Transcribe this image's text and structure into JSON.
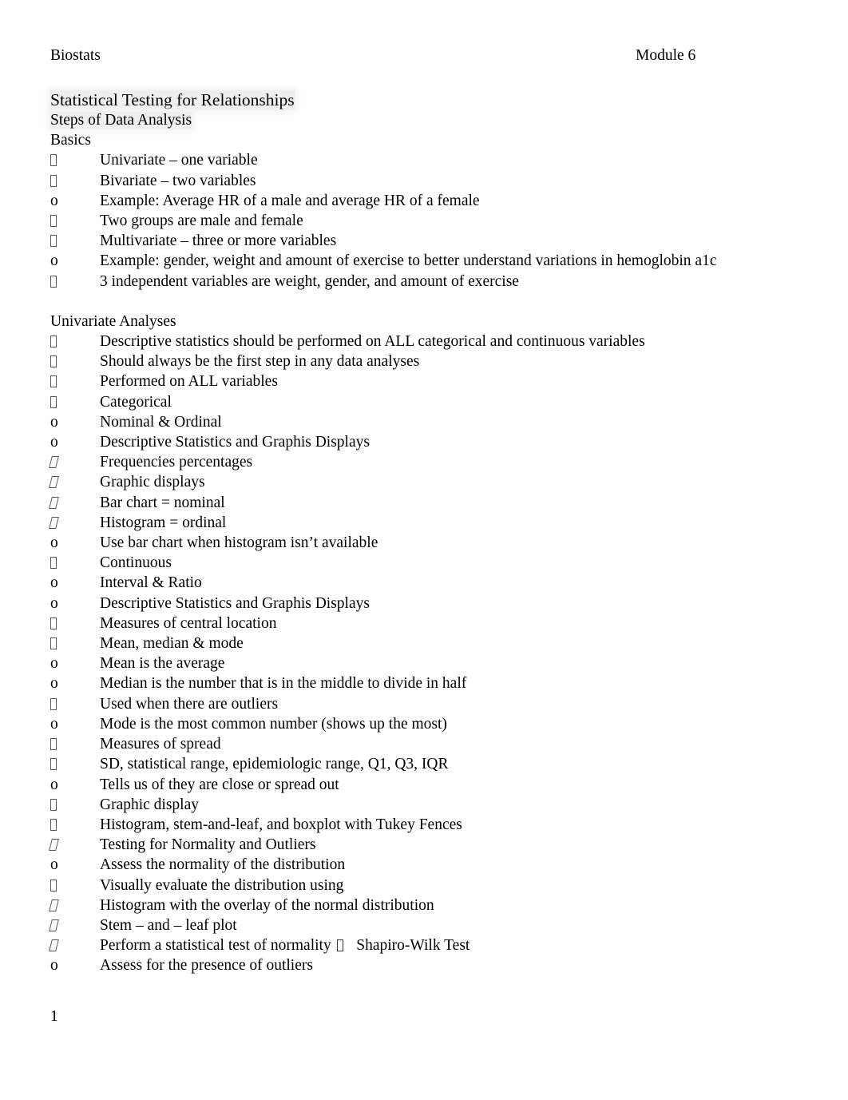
{
  "document": {
    "header": {
      "left": "Biostats",
      "right": "Module 6"
    },
    "footer": {
      "page_number": "1"
    },
    "title_lines": [
      "Statistical Testing for Relationships",
      "Steps of Data Analysis"
    ],
    "sections": [
      {
        "heading": "Basics",
        "items": [
          {
            "level": 1,
            "bullet": "tofu",
            "text": "Univariate – one variable"
          },
          {
            "level": 1,
            "bullet": "tofu",
            "text": "Bivariate – two variables"
          },
          {
            "level": 2,
            "bullet": "o",
            "text": "Example: Average HR of a male and average HR of a female"
          },
          {
            "level": 3,
            "bullet": "tofu",
            "text": "Two groups are male and female"
          },
          {
            "level": 1,
            "bullet": "tofu",
            "text": "Multivariate – three or more variables"
          },
          {
            "level": 2,
            "bullet": "o",
            "text": "Example: gender, weight and amount of exercise to better understand variations in hemoglobin a1c"
          },
          {
            "level": 3,
            "bullet": "tofu",
            "text": "3 independent variables are weight, gender, and amount of exercise"
          }
        ]
      },
      {
        "heading": "Univariate Analyses",
        "items": [
          {
            "level": 1,
            "bullet": "tofu",
            "text": "Descriptive statistics should be performed on ALL categorical and continuous variables"
          },
          {
            "level": 1,
            "bullet": "tofu",
            "text": "Should always be the first step in any data analyses"
          },
          {
            "level": 1,
            "bullet": "tofu",
            "text": "Performed on ALL variables"
          },
          {
            "level": 1,
            "bullet": "tofu",
            "text": "Categorical"
          },
          {
            "level": 2,
            "bullet": "o",
            "text": "Nominal & Ordinal"
          },
          {
            "level": 2,
            "bullet": "o",
            "text": "Descriptive Statistics and Graphis Displays"
          },
          {
            "level": 3,
            "bullet": "tofu-i",
            "text": "Frequencies percentages"
          },
          {
            "level": 3,
            "bullet": "tofu-i",
            "text": "Graphic displays"
          },
          {
            "level": 4,
            "bullet": "tofu-i",
            "text": "Bar chart = nominal"
          },
          {
            "level": 4,
            "bullet": "tofu-i",
            "text": "Histogram = ordinal"
          },
          {
            "level": 5,
            "bullet": "o",
            "text": "Use bar chart when histogram isn’t available"
          },
          {
            "level": 1,
            "bullet": "tofu",
            "text": "Continuous"
          },
          {
            "level": 2,
            "bullet": "o",
            "text": "Interval & Ratio"
          },
          {
            "level": 2,
            "bullet": "o",
            "text": "Descriptive Statistics and Graphis Displays"
          },
          {
            "level": 3,
            "bullet": "tofu",
            "text": "Measures of central location"
          },
          {
            "level": 4,
            "bullet": "tofu",
            "text": "Mean, median & mode"
          },
          {
            "level": 5,
            "bullet": "o",
            "text": "Mean is the average"
          },
          {
            "level": 5,
            "bullet": "o",
            "text": "Median is the number that is in the middle to divide in half"
          },
          {
            "level": 6,
            "bullet": "tofu",
            "text": "Used when there are outliers"
          },
          {
            "level": 5,
            "bullet": "o",
            "text": "Mode is the most common number (shows up the most)"
          },
          {
            "level": 3,
            "bullet": "tofu",
            "text": "Measures of spread"
          },
          {
            "level": 4,
            "bullet": "tofu",
            "text": "SD, statistical range, epidemiologic range, Q1, Q3, IQR"
          },
          {
            "level": 5,
            "bullet": "o",
            "text": "Tells us of they are close or spread out"
          },
          {
            "level": 3,
            "bullet": "tofu",
            "text": "Graphic display"
          },
          {
            "level": 4,
            "bullet": "tofu",
            "text": "Histogram, stem-and-leaf, and boxplot with Tukey Fences"
          },
          {
            "level": 1,
            "bullet": "tofu-i",
            "text": "Testing for Normality and Outliers"
          },
          {
            "level": 2,
            "bullet": "o",
            "text": "Assess the normality of the distribution"
          },
          {
            "level": 3,
            "bullet": "tofu",
            "text": "Visually evaluate the distribution using"
          },
          {
            "level": 4,
            "bullet": "tofu-i",
            "text": "Histogram with the overlay of the normal distribution"
          },
          {
            "level": 4,
            "bullet": "tofu-i",
            "text": "Stem – and – leaf plot"
          },
          {
            "level": 3,
            "bullet": "tofu-i",
            "text_before": "Perform a statistical test of normality ",
            "inline_tofu": true,
            "text_after": "   Shapiro-Wilk Test"
          },
          {
            "level": 2,
            "bullet": "o",
            "text": "Assess for the presence of outliers"
          }
        ]
      }
    ]
  }
}
